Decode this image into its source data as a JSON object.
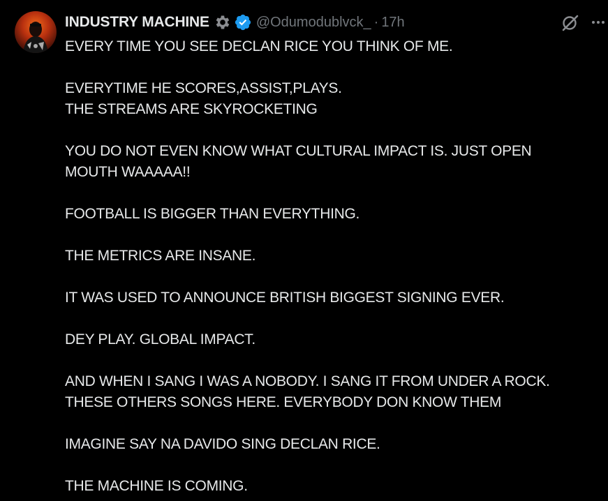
{
  "tweet": {
    "author": {
      "display_name": "INDUSTRY MACHINE",
      "handle": "@Odumodublvck_",
      "separator": "·",
      "time": "17h",
      "badges": [
        "gear-icon",
        "verified-icon"
      ]
    },
    "paragraphs": [
      [
        "EVERY TIME YOU SEE DECLAN RICE YOU THINK OF ME."
      ],
      [
        "EVERYTIME HE SCORES,ASSIST,PLAYS.",
        "THE STREAMS ARE SKYROCKETING"
      ],
      [
        "YOU DO NOT EVEN KNOW WHAT CULTURAL IMPACT IS. JUST OPEN",
        "MOUTH WAAAAA!!"
      ],
      [
        "FOOTBALL IS BIGGER THAN EVERYTHING."
      ],
      [
        "THE METRICS ARE INSANE."
      ],
      [
        "IT WAS USED TO ANNOUNCE BRITISH BIGGEST SIGNING EVER."
      ],
      [
        "DEY PLAY. GLOBAL IMPACT."
      ],
      [
        "AND WHEN I SANG I WAS A NOBODY. I SANG IT FROM UNDER A ROCK.",
        "THESE OTHERS SONGS HERE. EVERYBODY DON KNOW THEM"
      ],
      [
        "IMAGINE SAY NA DAVIDO SING DECLAN RICE."
      ],
      [
        "THE MACHINE IS COMING."
      ]
    ]
  },
  "colors": {
    "background": "#000000",
    "text": "#e7e9ea",
    "secondary_text": "#71767b",
    "verified_blue": "#1d9bf0"
  }
}
